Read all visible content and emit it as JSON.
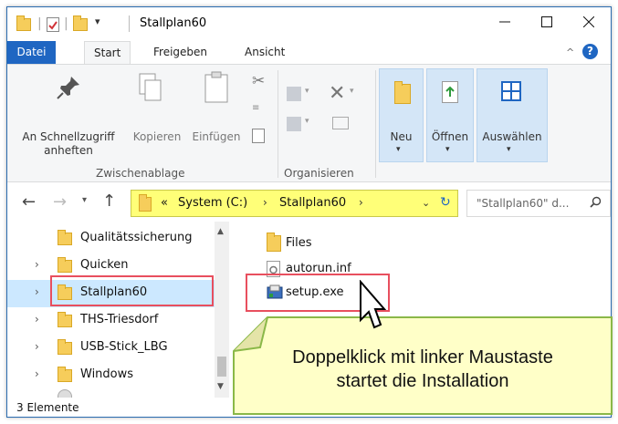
{
  "window": {
    "title": "Stallplan60"
  },
  "tabs": [
    {
      "label": "Datei"
    },
    {
      "label": "Start"
    },
    {
      "label": "Freigeben"
    },
    {
      "label": "Ansicht"
    }
  ],
  "ribbon": {
    "pin_line1": "An Schnellzugriff",
    "pin_line2": "anheften",
    "copy": "Kopieren",
    "paste": "Einfügen",
    "clipboard_group": "Zwischenablage",
    "organize_group": "Organisieren",
    "new": "Neu",
    "open": "Öffnen",
    "select": "Auswählen"
  },
  "address": {
    "prefix": "«",
    "crumbs": [
      "System (C:)",
      "Stallplan60"
    ],
    "search_placeholder": "\"Stallplan60\" d..."
  },
  "nav": {
    "items": [
      {
        "label": "Qualitätssicherung"
      },
      {
        "label": "Quicken"
      },
      {
        "label": "Stallplan60"
      },
      {
        "label": "THS-Triesdorf"
      },
      {
        "label": "USB-Stick_LBG"
      },
      {
        "label": "Windows"
      }
    ]
  },
  "files": {
    "items": [
      {
        "name": "Files"
      },
      {
        "name": "autorun.inf"
      },
      {
        "name": "setup.exe"
      }
    ]
  },
  "status": {
    "text": "3 Elemente"
  },
  "callout": {
    "line1": "Doppelklick mit linker Maustaste",
    "line2": "startet die Installation"
  },
  "colors": {
    "highlight_red": "#e84f5e",
    "address_yellow": "#ffff78",
    "callout_fill": "#ffffc8",
    "callout_border": "#8ab848",
    "tab_blue": "#1f66c2"
  }
}
